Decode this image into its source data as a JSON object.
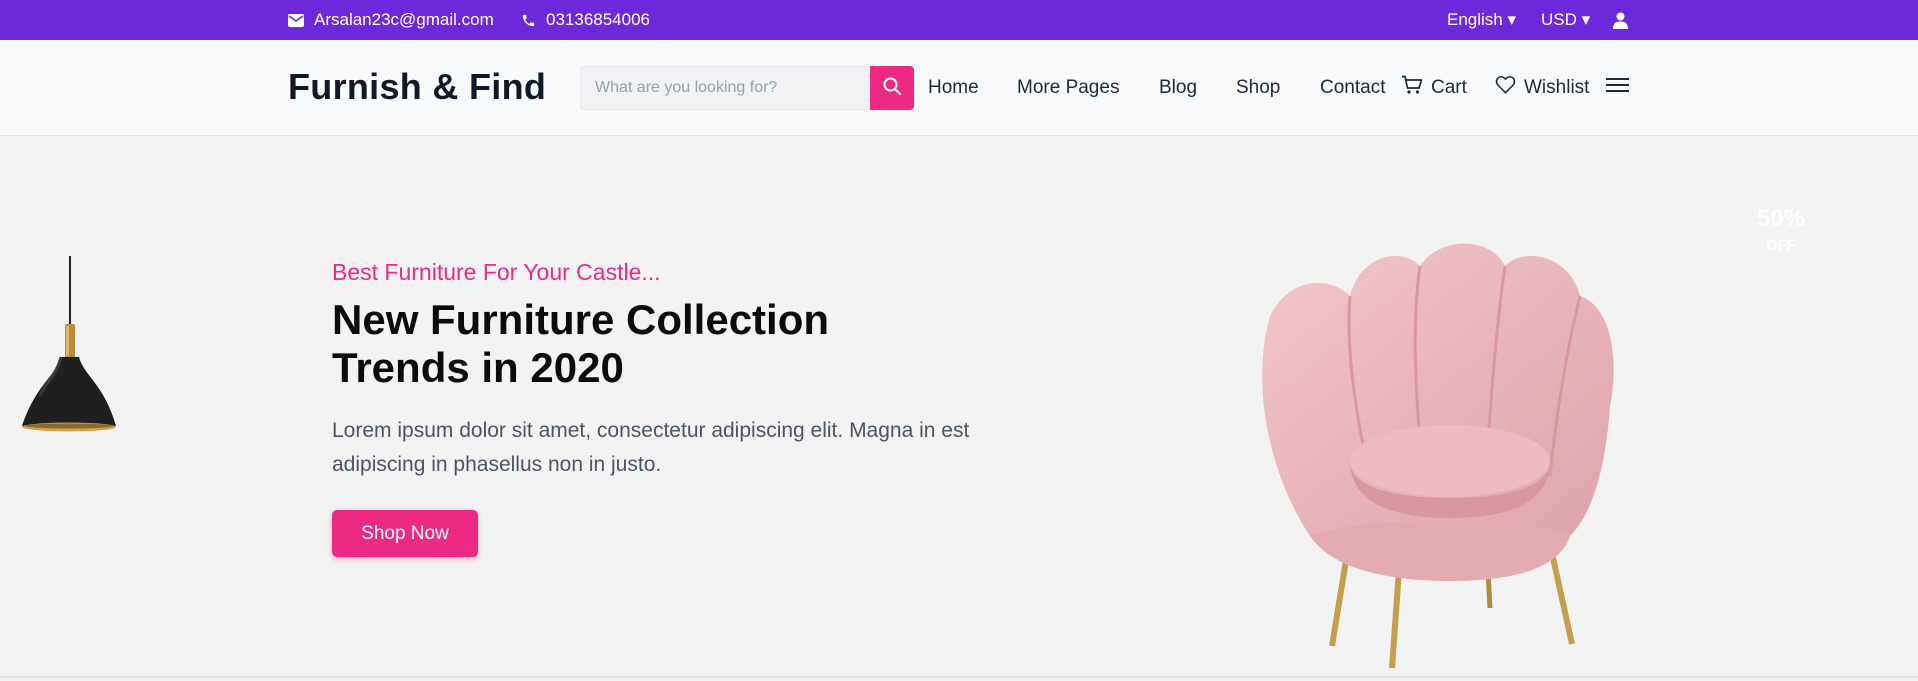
{
  "topbar": {
    "email": "Arsalan23c@gmail.com",
    "phone": "03136854006",
    "language": "English ▾",
    "currency": "USD ▾"
  },
  "header": {
    "logo": "Furnish & Find",
    "search_placeholder": "What are you looking for?",
    "nav": {
      "home": "Home",
      "more_pages": "More Pages",
      "blog": "Blog",
      "shop": "Shop",
      "contact": "Contact",
      "cart": "Cart",
      "wishlist": "Wishlist"
    }
  },
  "hero": {
    "subtitle": "Best Furniture For Your Castle...",
    "title": "New Furniture Collection Trends in 2020",
    "description": "Lorem ipsum dolor sit amet, consectetur adipiscing elit. Magna in est adipiscing in phasellus non in justo.",
    "cta": "Shop Now",
    "discount_percent": "50%",
    "discount_label": "OFF"
  },
  "colors": {
    "topbar": "#6d28d9",
    "accent": "#ec2a84",
    "hero_bg": "#f3f3f3"
  },
  "icons": [
    "envelope-icon",
    "phone-icon",
    "user-icon",
    "search-icon",
    "cart-icon",
    "heart-icon",
    "menu-icon"
  ]
}
